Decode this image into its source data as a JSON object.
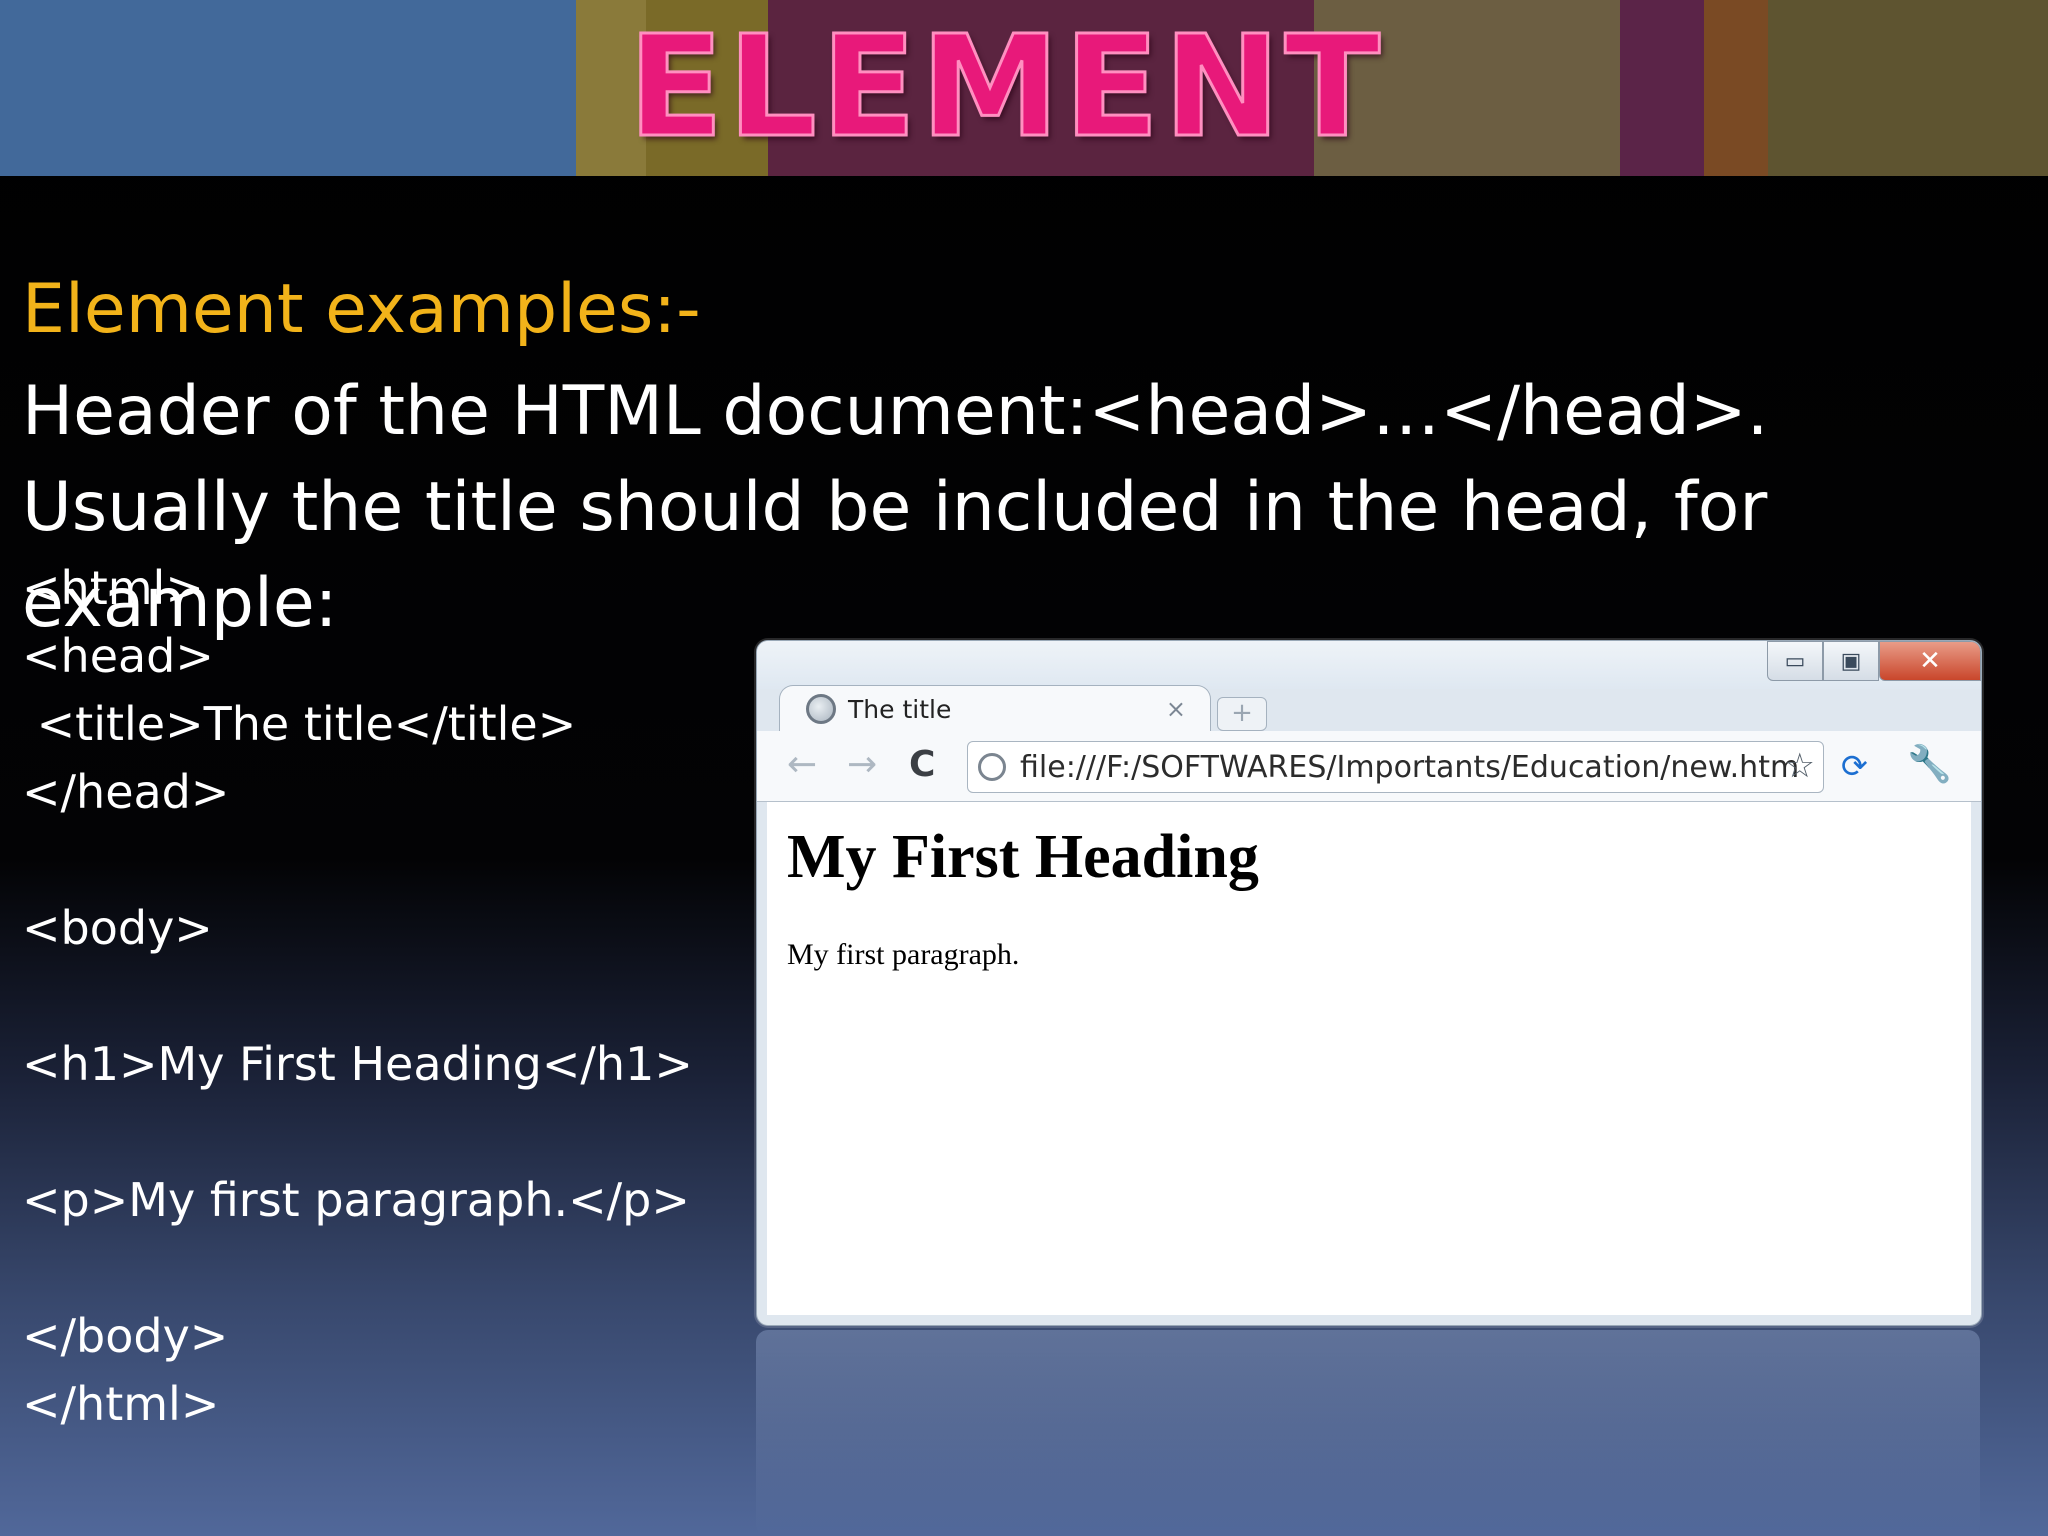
{
  "banner": {
    "title": "ELEMENT",
    "stripe_colors": [
      "#42699a",
      "#8a7a3a",
      "#7a6a28",
      "#5b2440",
      "#6c5e42",
      "#5b2448",
      "#7a4a24",
      "#5e5430"
    ]
  },
  "slide": {
    "heading": "Element examples:-",
    "body": "Header of the HTML document:<head>…</head>. Usually the title should be included in the head, for example:",
    "code_lines": [
      "<html>",
      "<head>",
      " <title>The title</title>",
      "</head>",
      "",
      "<body>",
      "",
      "<h1>My First Heading</h1>",
      "",
      "<p>My first paragraph.</p>",
      "",
      "</body>",
      "</html>"
    ]
  },
  "browser": {
    "tab_title": "The title",
    "tab_close": "×",
    "new_tab": "+",
    "url": "file:///F:/SOFTWARES/Importants/Education/new.htm",
    "page_heading": "My First Heading",
    "page_paragraph": "My first paragraph.",
    "window_buttons": {
      "minimize": "▭",
      "maximize": "▣",
      "close": "✕"
    },
    "icons": {
      "back": "back-arrow-icon",
      "forward": "forward-arrow-icon",
      "reload": "reload-icon",
      "star": "star-icon",
      "sync": "sync-icon",
      "wrench": "wrench-icon",
      "globe": "globe-icon"
    },
    "glyphs": {
      "back": "←",
      "forward": "→",
      "reload": "C",
      "star": "☆",
      "sync": "⟳",
      "wrench": "🔧"
    }
  }
}
